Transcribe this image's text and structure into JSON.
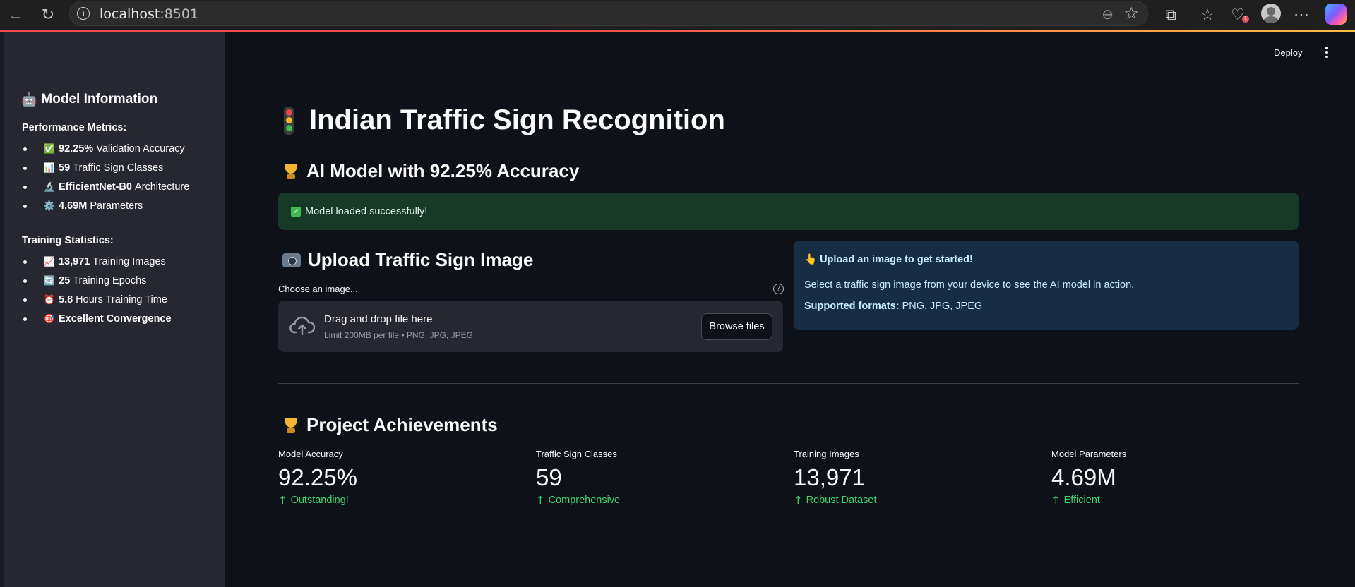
{
  "browser": {
    "url_host": "localhost",
    "url_port": ":8501",
    "health_badge": "1"
  },
  "header": {
    "deploy_label": "Deploy"
  },
  "sidebar": {
    "title": "Model Information",
    "performance_heading": "Performance Metrics:",
    "performance_items": [
      {
        "icon": "✅",
        "bold": "92.25%",
        "text": "Validation Accuracy"
      },
      {
        "icon": "📊",
        "bold": "59",
        "text": "Traffic Sign Classes"
      },
      {
        "icon": "🔬",
        "bold": "EfficientNet-B0",
        "text": "Architecture"
      },
      {
        "icon": "⚙️",
        "bold": "4.69M",
        "text": "Parameters"
      }
    ],
    "training_heading": "Training Statistics:",
    "training_items": [
      {
        "icon": "📈",
        "bold": "13,971",
        "text": "Training Images"
      },
      {
        "icon": "🔄",
        "bold": "25",
        "text": "Training Epochs"
      },
      {
        "icon": "⏰",
        "bold": "5.8",
        "text": "Hours Training Time"
      },
      {
        "icon": "🎯",
        "bold": "Excellent Convergence",
        "text": ""
      }
    ]
  },
  "main": {
    "title": "Indian Traffic Sign Recognition",
    "subtitle": "AI Model with 92.25% Accuracy",
    "success_message": "Model loaded successfully!",
    "upload": {
      "heading": "Upload Traffic Sign Image",
      "label": "Choose an image...",
      "drop_title": "Drag and drop file here",
      "drop_limit": "Limit 200MB per file • PNG, JPG, JPEG",
      "browse_label": "Browse files"
    },
    "info": {
      "hand": "👆",
      "title": "Upload an image to get started!",
      "body": "Select a traffic sign image from your device to see the AI model in action.",
      "formats_label": "Supported formats:",
      "formats_value": "PNG, JPG, JPEG"
    },
    "achievements": {
      "heading": "Project Achievements",
      "metrics": [
        {
          "label": "Model Accuracy",
          "value": "92.25%",
          "delta": "Outstanding!"
        },
        {
          "label": "Traffic Sign Classes",
          "value": "59",
          "delta": "Comprehensive"
        },
        {
          "label": "Training Images",
          "value": "13,971",
          "delta": "Robust Dataset"
        },
        {
          "label": "Model Parameters",
          "value": "4.69M",
          "delta": "Efficient"
        }
      ]
    }
  },
  "colors": {
    "background": "#0e1117",
    "sidebar": "#262730",
    "success_bg": "#173928",
    "info_bg": "#172d43",
    "delta_green": "#3dd56d"
  }
}
